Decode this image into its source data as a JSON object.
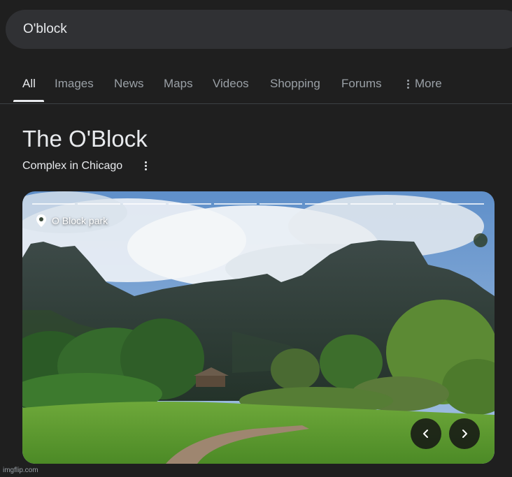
{
  "search": {
    "query": "O'block"
  },
  "tabs": [
    {
      "label": "All"
    },
    {
      "label": "Images"
    },
    {
      "label": "News"
    },
    {
      "label": "Maps"
    },
    {
      "label": "Videos"
    },
    {
      "label": "Shopping"
    },
    {
      "label": "Forums"
    },
    {
      "label": "More"
    }
  ],
  "knowledge_panel": {
    "title": "The O'Block",
    "subtitle": "Complex in Chicago",
    "image_caption": "O Block park",
    "carousel_count": 10
  },
  "watermark": "imgflip.com",
  "icons": {
    "more": "more-vert-icon",
    "pin": "location-pin-icon",
    "prev": "chevron-left-icon",
    "next": "chevron-right-icon"
  },
  "colors": {
    "background": "#1f1f1f",
    "search_bg": "#303134",
    "text": "#e8eaed",
    "muted": "#9aa0a6"
  }
}
